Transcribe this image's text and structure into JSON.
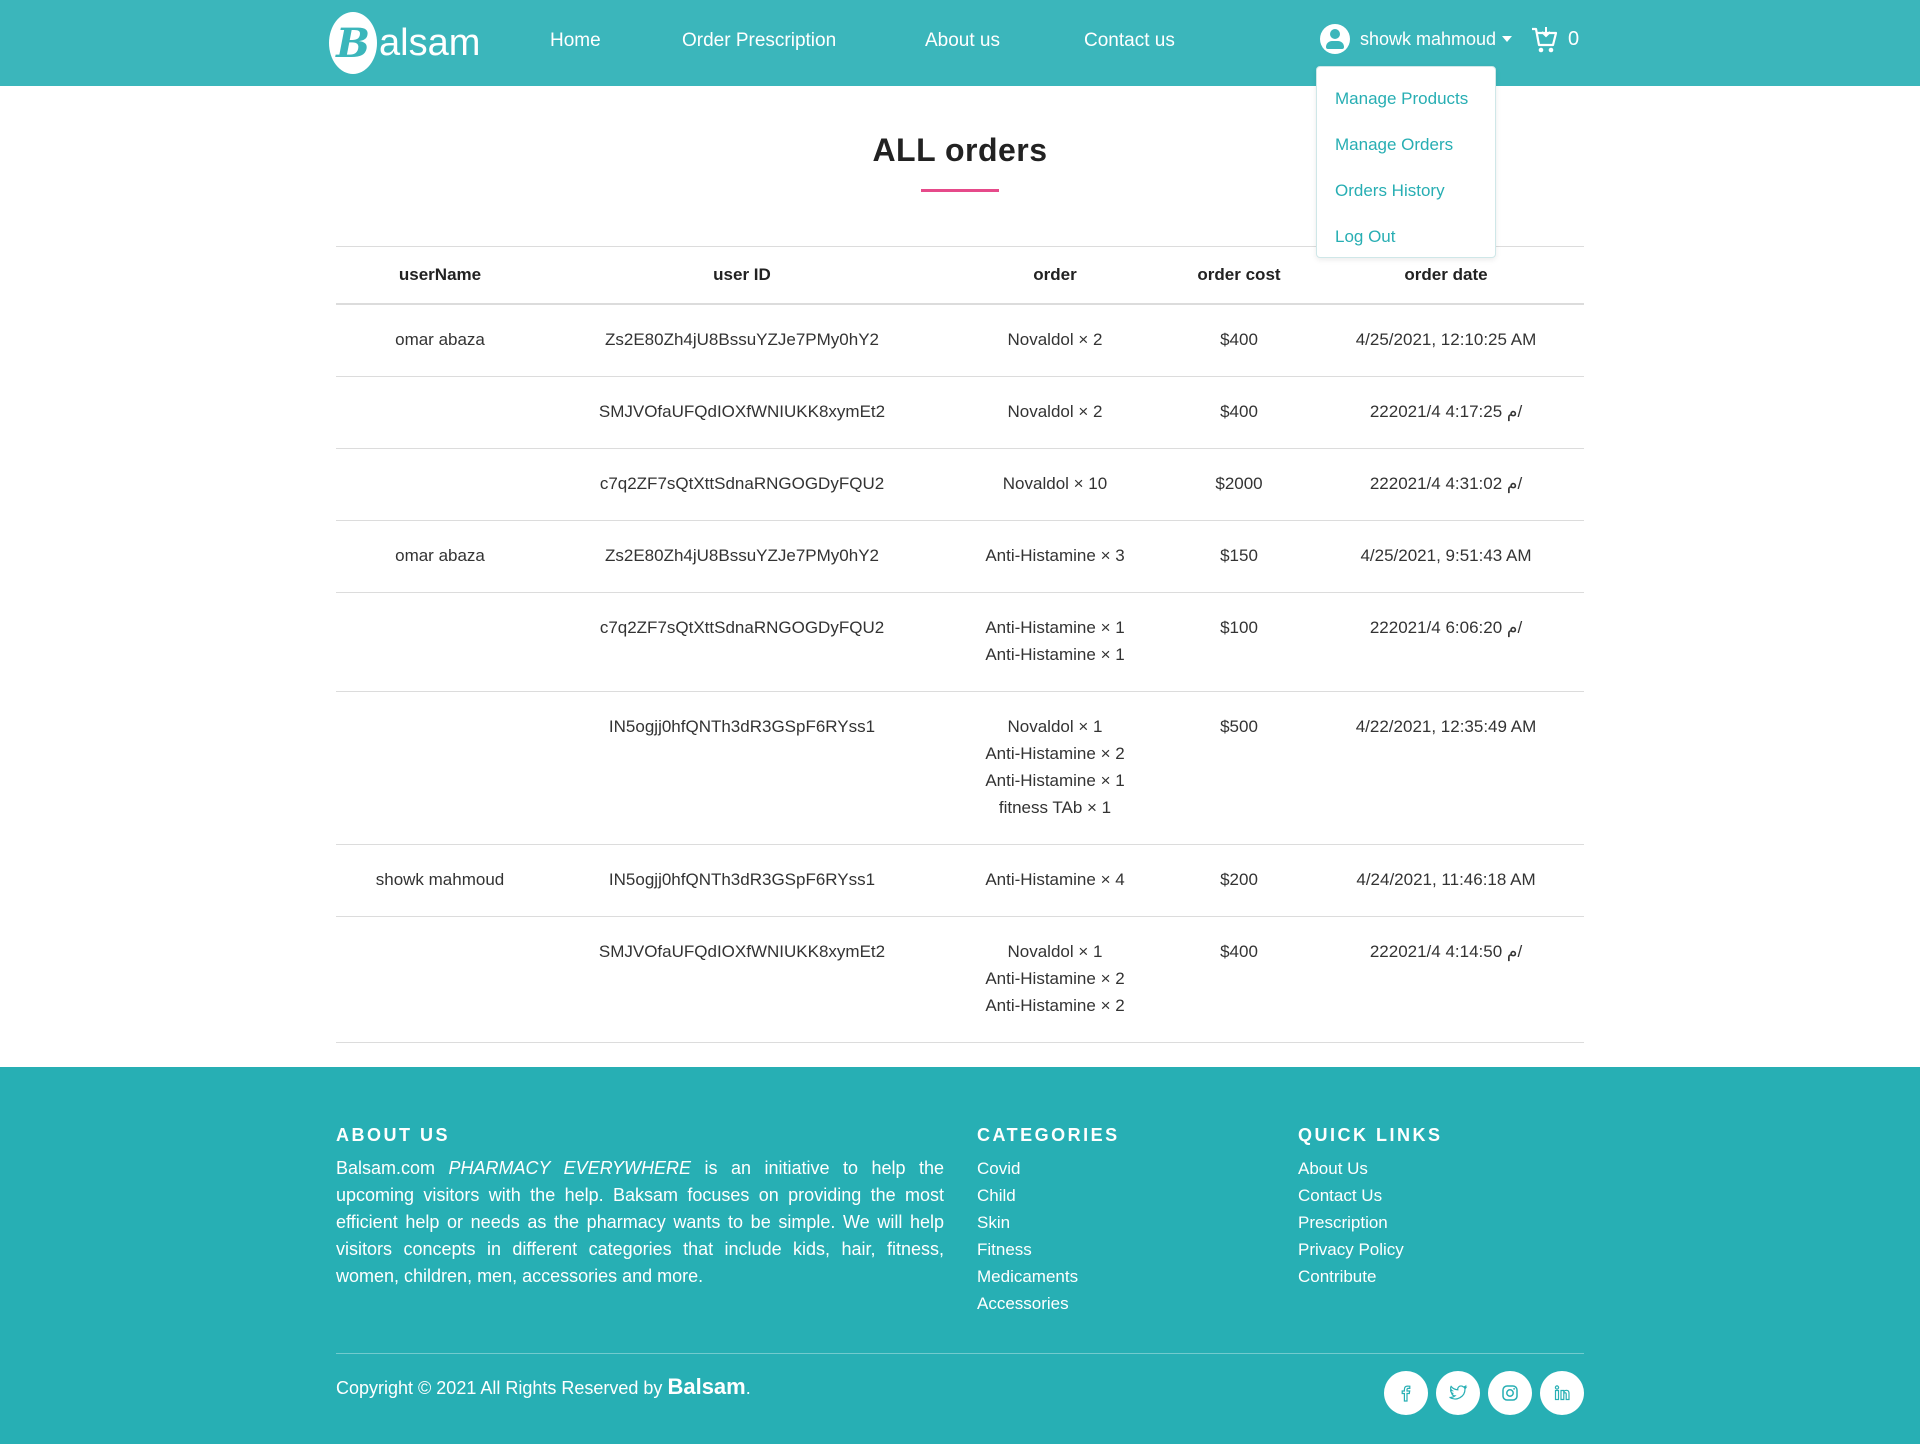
{
  "header": {
    "logo_letter": "B",
    "logo_text": "alsam",
    "nav": [
      "Home",
      "Order Prescription",
      "About us",
      "Contact us"
    ],
    "user_name": "showk mahmoud",
    "cart_count": "0"
  },
  "dropdown": {
    "items": [
      "Manage Products",
      "Manage Orders",
      "Orders History",
      "Log Out"
    ]
  },
  "main": {
    "title": "ALL orders",
    "columns": [
      "userName",
      "user ID",
      "order",
      "order cost",
      "order date"
    ],
    "rows": [
      {
        "user": "omar abaza",
        "id": "Zs2E80Zh4jU8BssuYZJe7PMy0hY2",
        "items": [
          "Novaldol × 2"
        ],
        "cost": "$400",
        "date": "4/25/2021, 12:10:25 AM"
      },
      {
        "user": "",
        "id": "SMJVOfaUFQdIOXfWNIUKK8xymEt2",
        "items": [
          "Novaldol × 2"
        ],
        "cost": "$400",
        "date": "22م 4:17:25 2021/4/"
      },
      {
        "user": "",
        "id": "c7q2ZF7sQtXttSdnaRNGOGDyFQU2",
        "items": [
          "Novaldol × 10"
        ],
        "cost": "$2000",
        "date": "22م 4:31:02 2021/4/"
      },
      {
        "user": "omar abaza",
        "id": "Zs2E80Zh4jU8BssuYZJe7PMy0hY2",
        "items": [
          "Anti-Histamine × 3"
        ],
        "cost": "$150",
        "date": "4/25/2021, 9:51:43 AM"
      },
      {
        "user": "",
        "id": "c7q2ZF7sQtXttSdnaRNGOGDyFQU2",
        "items": [
          "Anti-Histamine × 1",
          "Anti-Histamine × 1"
        ],
        "cost": "$100",
        "date": "22م 6:06:20 2021/4/"
      },
      {
        "user": "",
        "id": "IN5ogjj0hfQNTh3dR3GSpF6RYss1",
        "items": [
          "Novaldol × 1",
          "Anti-Histamine × 2",
          "Anti-Histamine × 1",
          "fitness TAb × 1"
        ],
        "cost": "$500",
        "date": "4/22/2021, 12:35:49 AM"
      },
      {
        "user": "showk mahmoud",
        "id": "IN5ogjj0hfQNTh3dR3GSpF6RYss1",
        "items": [
          "Anti-Histamine × 4"
        ],
        "cost": "$200",
        "date": "4/24/2021, 11:46:18 AM"
      },
      {
        "user": "",
        "id": "SMJVOfaUFQdIOXfWNIUKK8xymEt2",
        "items": [
          "Novaldol × 1",
          "Anti-Histamine × 2",
          "Anti-Histamine × 2"
        ],
        "cost": "$400",
        "date": "22م 4:14:50 2021/4/"
      }
    ]
  },
  "footer": {
    "about_heading": "ABOUT US",
    "about_lead": "Balsam.com",
    "about_tagline": "PHARMACY EVERYWHERE",
    "about_body": "is an initiative to help the upcoming visitors with the help. Baksam focuses on providing the most efficient help or needs as the pharmacy wants to be simple. We will help visitors concepts in different categories that include kids, hair, fitness, women, children, men, accessories and more.",
    "categories_heading": "CATEGORIES",
    "categories": [
      "Covid",
      "Child",
      "Skin",
      "Fitness",
      "Medicaments",
      "Accessories"
    ],
    "quick_heading": "QUICK LINKS",
    "quick_links": [
      "About Us",
      "Contact Us",
      "Prescription",
      "Privacy Policy",
      "Contribute"
    ],
    "copyright": "Copyright © 2021 All Rights Reserved by",
    "brand": "Balsam",
    "social": [
      "facebook-icon",
      "twitter-icon",
      "instagram-icon",
      "linkedin-icon"
    ]
  },
  "colors": {
    "header_bg": "#3bb6bb",
    "footer_bg": "#27afb4",
    "link": "#27aeb3",
    "accent_underline": "#e64a8a"
  }
}
